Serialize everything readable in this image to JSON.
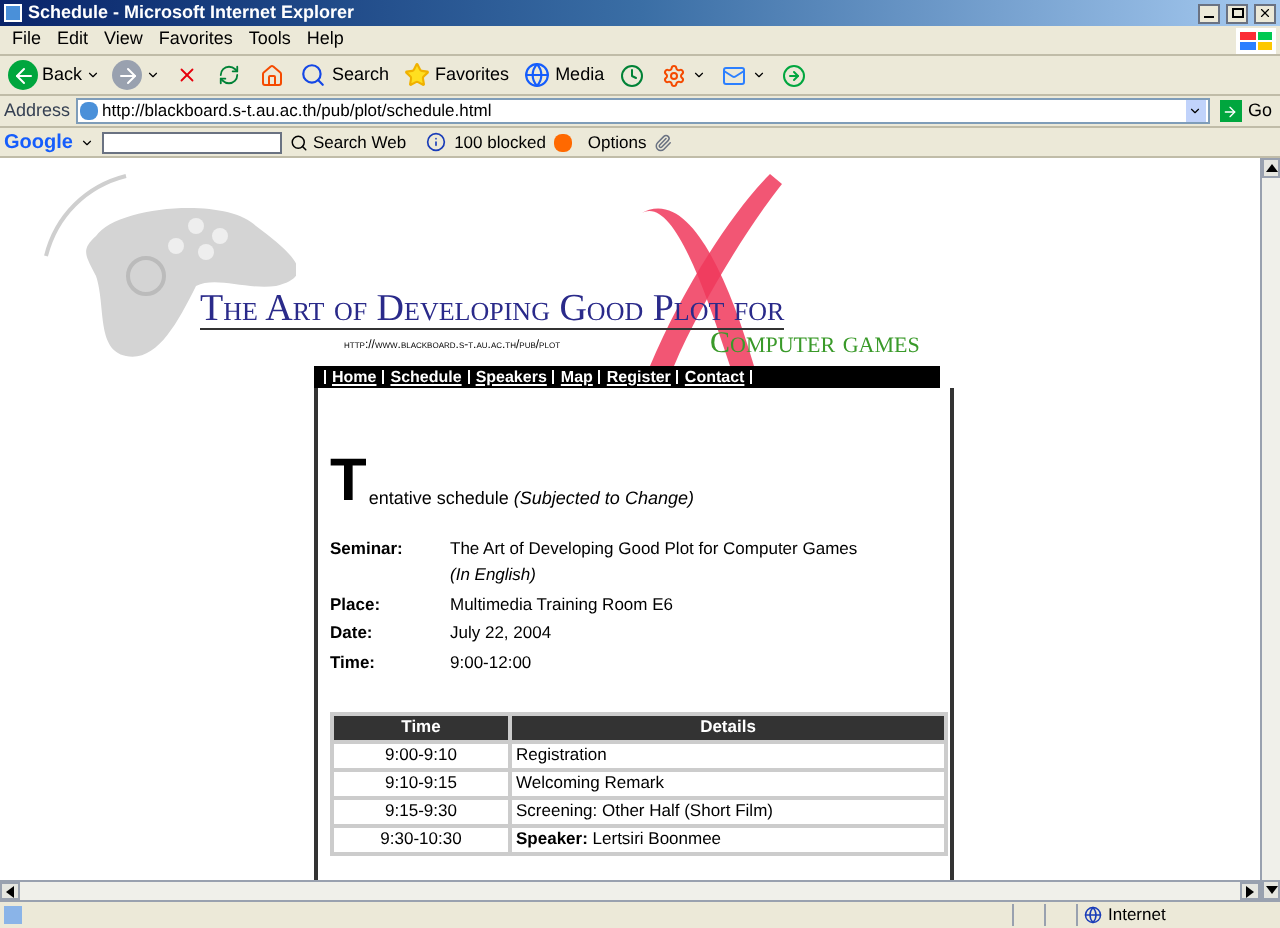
{
  "window": {
    "title": "Schedule - Microsoft Internet Explorer"
  },
  "menu": [
    "File",
    "Edit",
    "View",
    "Favorites",
    "Tools",
    "Help"
  ],
  "toolbar": [
    {
      "kind": "back",
      "label": "Back",
      "dropdown": true
    },
    {
      "kind": "forward",
      "dropdown": true
    },
    {
      "kind": "stop"
    },
    {
      "kind": "refresh"
    },
    {
      "kind": "home"
    },
    {
      "kind": "search",
      "label": "Search"
    },
    {
      "kind": "favorites",
      "label": "Favorites"
    },
    {
      "kind": "media",
      "label": "Media"
    },
    {
      "kind": "history"
    },
    {
      "kind": "encoding",
      "dropdown": true
    },
    {
      "kind": "mail",
      "dropdown": true
    },
    {
      "kind": "messenger"
    }
  ],
  "address": {
    "label": "Address",
    "url": "http://blackboard.s-t.au.ac.th/pub/plot/schedule.html",
    "go": "Go"
  },
  "google_bar": {
    "logo": "Google",
    "search_web": "Search Web",
    "blocked": "100 blocked",
    "options": "Options"
  },
  "banner": {
    "title": "The Art of Developing Good Plot for",
    "subtitle": "Computer games",
    "url": "http://www.blackboard.s-t.au.ac.th/pub/plot"
  },
  "nav": [
    "Home",
    "Schedule",
    "Speakers",
    "Map",
    "Register",
    "Contact"
  ],
  "heading": {
    "initial": "T",
    "rest": "entative schedule",
    "note": "(Subjected to Change)"
  },
  "info": [
    {
      "label": "Seminar:",
      "value": "The Art of Developing Good Plot for Computer Games",
      "note": "(In English)"
    },
    {
      "label": "Place:",
      "value": "Multimedia Training Room E6"
    },
    {
      "label": "Date:",
      "value": "July 22, 2004"
    },
    {
      "label": "Time:",
      "value": "9:00-12:00"
    }
  ],
  "table": {
    "columns": [
      "Time",
      "Details"
    ],
    "rows": [
      {
        "time": "9:00-9:10",
        "details": "Registration"
      },
      {
        "time": "9:10-9:15",
        "details": "Welcoming Remark"
      },
      {
        "time": "9:15-9:30",
        "details": "Screening: Other Half (Short Film)"
      },
      {
        "time": "9:30-10:30",
        "details": "**Speaker:** Lertsiri Boonmee"
      }
    ]
  },
  "status_bar": {
    "zone": "Internet"
  }
}
